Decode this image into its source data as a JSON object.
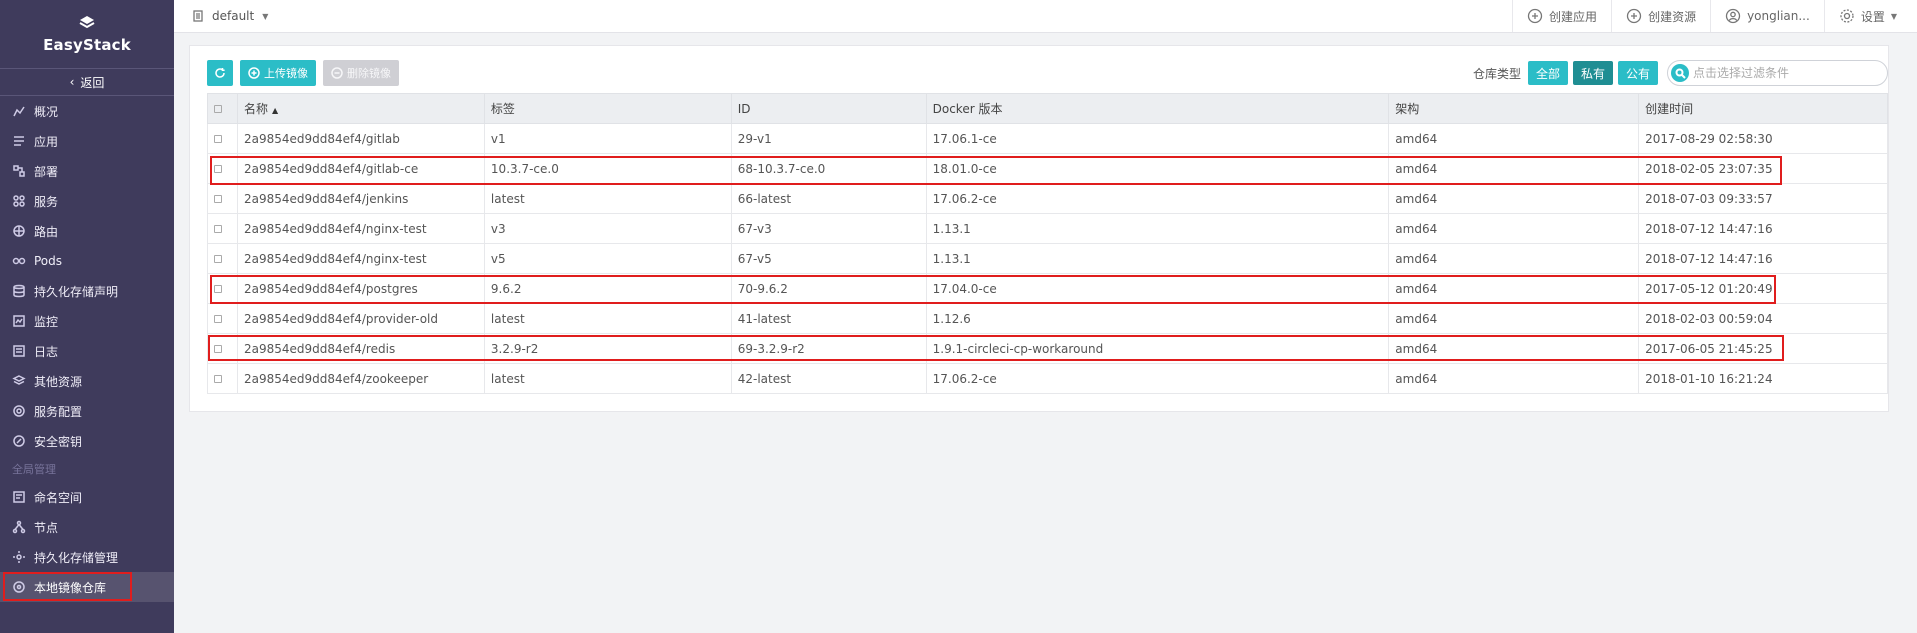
{
  "brand": "EasyStack",
  "sidebar": {
    "back_label": "返回",
    "items": [
      {
        "label": "概况",
        "icon": "overview-icon"
      },
      {
        "label": "应用",
        "icon": "app-icon"
      },
      {
        "label": "部署",
        "icon": "deploy-icon"
      },
      {
        "label": "服务",
        "icon": "service-icon"
      },
      {
        "label": "路由",
        "icon": "route-icon"
      },
      {
        "label": "Pods",
        "icon": "pods-icon"
      },
      {
        "label": "持久化存储声明",
        "icon": "storage-claim-icon"
      },
      {
        "label": "监控",
        "icon": "monitor-icon"
      },
      {
        "label": "日志",
        "icon": "log-icon"
      },
      {
        "label": "其他资源",
        "icon": "resources-icon"
      },
      {
        "label": "服务配置",
        "icon": "config-icon"
      },
      {
        "label": "安全密钥",
        "icon": "key-icon"
      }
    ],
    "section_label": "全局管理",
    "global_items": [
      {
        "label": "命名空间",
        "icon": "namespace-icon"
      },
      {
        "label": "节点",
        "icon": "node-icon"
      },
      {
        "label": "持久化存储管理",
        "icon": "storage-manage-icon"
      },
      {
        "label": "本地镜像仓库",
        "icon": "registry-icon"
      }
    ]
  },
  "topbar": {
    "namespace": "default",
    "create_app": "创建应用",
    "create_resource": "创建资源",
    "user": "yonglian...",
    "settings": "设置"
  },
  "toolbar": {
    "upload_label": "上传镜像",
    "delete_label": "删除镜像"
  },
  "filter": {
    "label": "仓库类型",
    "all": "全部",
    "private": "私有",
    "public": "公有",
    "search_placeholder": "点击选择过滤条件"
  },
  "table": {
    "headers": [
      "名称",
      "标签",
      "ID",
      "Docker 版本",
      "架构",
      "创建时间"
    ],
    "rows": [
      [
        "2a9854ed9dd84ef4/gitlab",
        "v1",
        "29-v1",
        "17.06.1-ce",
        "amd64",
        "2017-08-29 02:58:30"
      ],
      [
        "2a9854ed9dd84ef4/gitlab-ce",
        "10.3.7-ce.0",
        "68-10.3.7-ce.0",
        "18.01.0-ce",
        "amd64",
        "2018-02-05 23:07:35"
      ],
      [
        "2a9854ed9dd84ef4/jenkins",
        "latest",
        "66-latest",
        "17.06.2-ce",
        "amd64",
        "2018-07-03 09:33:57"
      ],
      [
        "2a9854ed9dd84ef4/nginx-test",
        "v3",
        "67-v3",
        "1.13.1",
        "amd64",
        "2018-07-12 14:47:16"
      ],
      [
        "2a9854ed9dd84ef4/nginx-test",
        "v5",
        "67-v5",
        "1.13.1",
        "amd64",
        "2018-07-12 14:47:16"
      ],
      [
        "2a9854ed9dd84ef4/postgres",
        "9.6.2",
        "70-9.6.2",
        "17.04.0-ce",
        "amd64",
        "2017-05-12 01:20:49"
      ],
      [
        "2a9854ed9dd84ef4/provider-old",
        "latest",
        "41-latest",
        "1.12.6",
        "amd64",
        "2018-02-03 00:59:04"
      ],
      [
        "2a9854ed9dd84ef4/redis",
        "3.2.9-r2",
        "69-3.2.9-r2",
        "1.9.1-circleci-cp-workaround",
        "amd64",
        "2017-06-05 21:45:25"
      ],
      [
        "2a9854ed9dd84ef4/zookeeper",
        "latest",
        "42-latest",
        "17.06.2-ce",
        "amd64",
        "2018-01-10 16:21:24"
      ]
    ]
  },
  "colors": {
    "sidebar_bg": "#3f3b5c",
    "accent": "#2bbdc7",
    "highlight_box": "#e01d1d"
  }
}
